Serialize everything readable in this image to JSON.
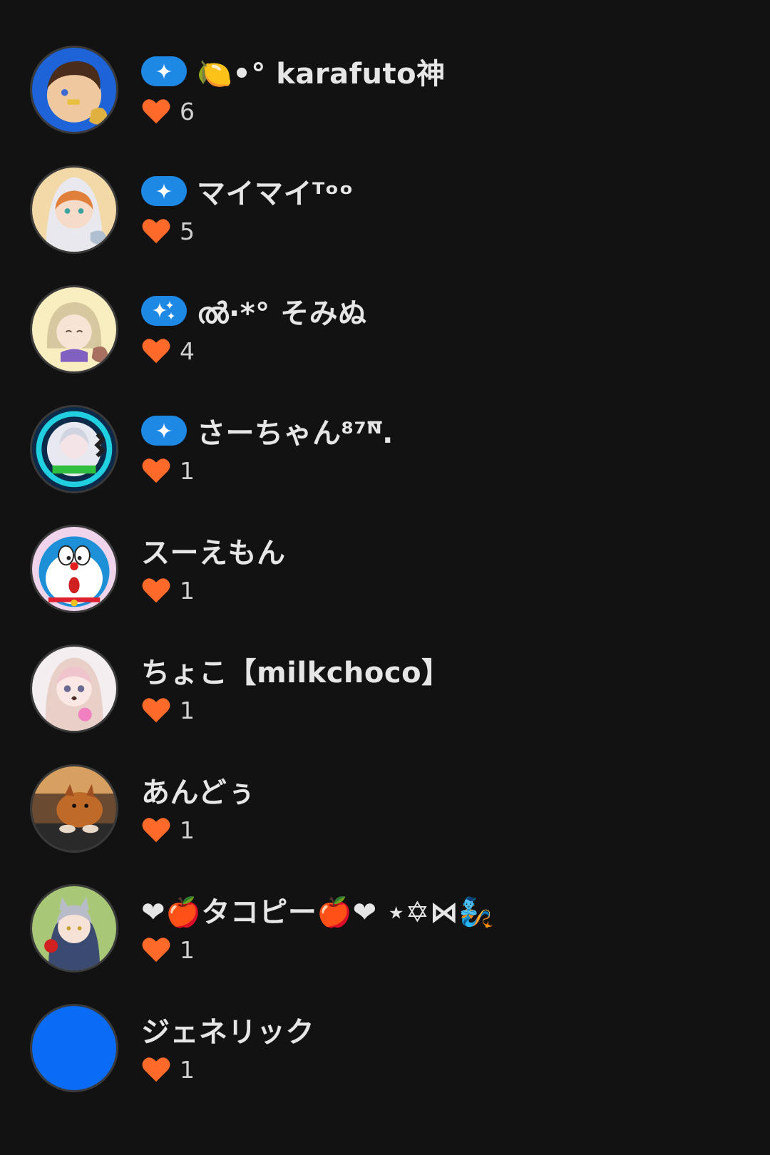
{
  "colors": {
    "background": "#121212",
    "badge": "#1e88e5",
    "heart": "#ff6a2b",
    "plain_avatar": "#0a6cf5"
  },
  "users": [
    {
      "name": "🍋•° karafuto神",
      "likes": "6",
      "badge": "single-sparkle",
      "avatar": "boy-anime"
    },
    {
      "name": "マイマイᵀᵒᵒ",
      "likes": "5",
      "badge": "single-sparkle",
      "avatar": "girl-anime-hood"
    },
    {
      "name": "ൽ·*° そみぬ",
      "likes": "4",
      "badge": "double-sparkle",
      "avatar": "chibi-girl"
    },
    {
      "name": "さーちゃん⁸⁷ᴺ̅.",
      "likes": "1",
      "badge": "single-sparkle",
      "avatar": "racing-emblem"
    },
    {
      "name": "スーえもん",
      "likes": "1",
      "badge": "none",
      "avatar": "doraemon"
    },
    {
      "name": "ちょこ【milkchoco】",
      "likes": "1",
      "badge": "none",
      "avatar": "girl-chocolate"
    },
    {
      "name": "あんどぅ",
      "likes": "1",
      "badge": "none",
      "avatar": "dog-photo"
    },
    {
      "name": "❤︎🍎タコピー🍎❤︎ ⋆✡⋈🧞",
      "likes": "1",
      "badge": "none",
      "avatar": "boy-apple"
    },
    {
      "name": "ジェネリック",
      "likes": "1",
      "badge": "none",
      "avatar": "plain-blue"
    }
  ]
}
